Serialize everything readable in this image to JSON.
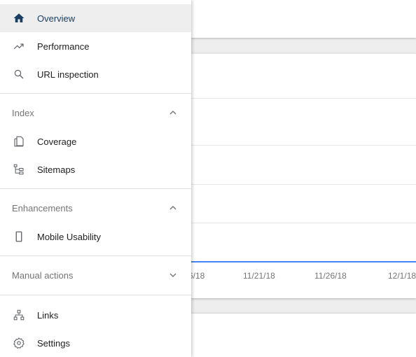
{
  "nav": {
    "top_items": [
      {
        "label": "Overview",
        "icon": "home-icon",
        "active": true
      },
      {
        "label": "Performance",
        "icon": "trending-up-icon"
      },
      {
        "label": "URL inspection",
        "icon": "search-icon"
      }
    ],
    "sections": [
      {
        "label": "Index",
        "expanded": true,
        "items": [
          {
            "label": "Coverage",
            "icon": "coverage-icon"
          },
          {
            "label": "Sitemaps",
            "icon": "sitemap-icon"
          }
        ]
      },
      {
        "label": "Enhancements",
        "expanded": true,
        "items": [
          {
            "label": "Mobile Usability",
            "icon": "mobile-icon"
          }
        ]
      },
      {
        "label": "Manual actions",
        "expanded": false,
        "items": []
      }
    ],
    "bottom_items": [
      {
        "label": "Links",
        "icon": "links-icon"
      },
      {
        "label": "Settings",
        "icon": "settings-icon"
      }
    ]
  },
  "chart": {
    "x_ticks": [
      "6/18",
      "11/21/18",
      "11/26/18",
      "12/1/18"
    ],
    "line_color": "#4285f4"
  },
  "colors": {
    "active_bg": "#eeeeee",
    "active_text": "#1a3f63",
    "icon": "#5f6368"
  }
}
